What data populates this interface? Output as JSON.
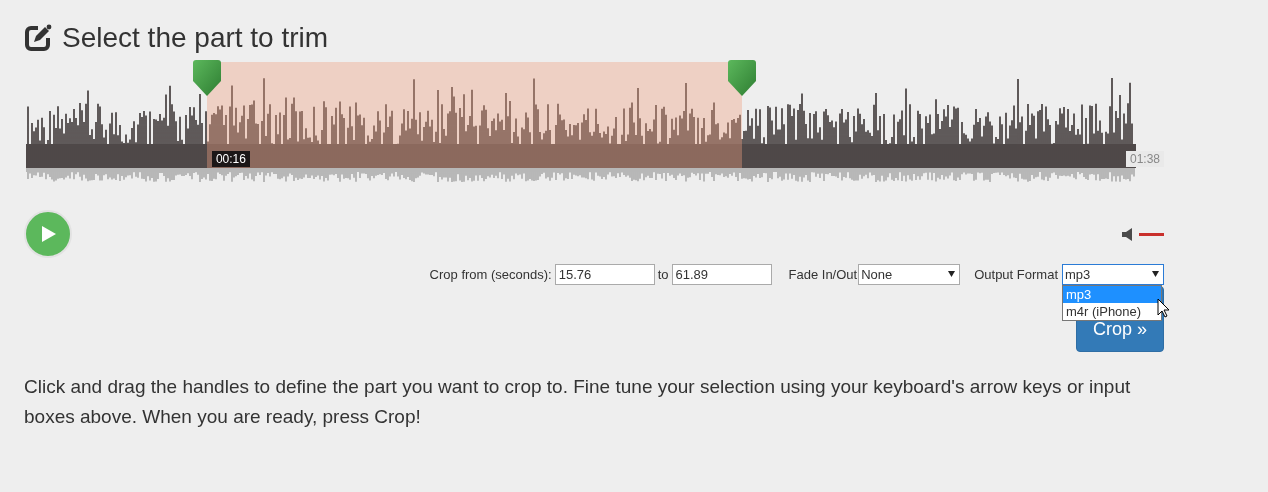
{
  "title": "Select the part to trim",
  "waveform": {
    "handles": [
      {
        "level": 0.163
      },
      {
        "level": 0.645
      }
    ],
    "start_time": "00:16",
    "end_time": "01:38"
  },
  "volume": {
    "level": 1
  },
  "crop_form": {
    "from_label": "Crop from (seconds):",
    "from_value": "15.76",
    "to_label": "to",
    "to_value": "61.89",
    "fade_label": "Fade In/Out",
    "fade_value": "None",
    "format_label": "Output Format",
    "format_value": "mp3",
    "format_open": true,
    "format_options": [
      {
        "label": "mp3",
        "selected": true
      },
      {
        "label": "m4r (iPhone)",
        "selected": false
      }
    ],
    "crop_button": "Crop »"
  },
  "help": "Click and drag the handles to define the part you want to crop to. Fine tune your selection using your keyboard's arrow keys or input boxes above. When you are ready, press Crop!"
}
